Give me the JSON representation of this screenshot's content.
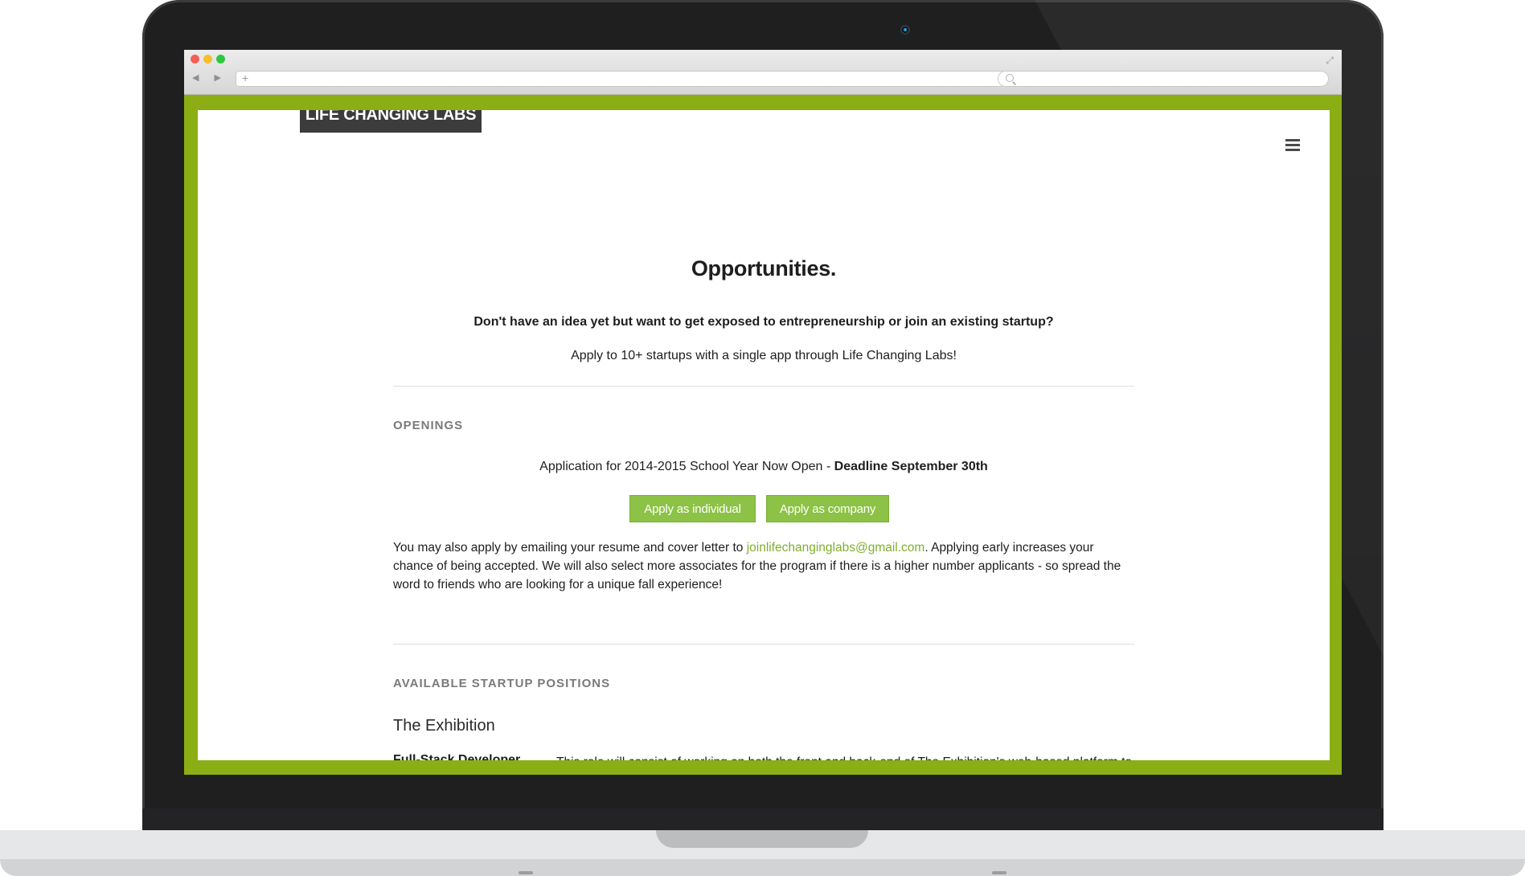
{
  "browser": {
    "nav_arrows": "◀ ▶",
    "new_tab": "+",
    "expand": "⤢"
  },
  "site": {
    "logo": "LIFE CHANGING LABS",
    "menu_icon": "hamburger-icon"
  },
  "hero": {
    "title": "Opportunities.",
    "question": "Don't have an idea yet but want to get exposed to entrepreneurship or join an existing startup?",
    "subtitle": "Apply to 10+ startups with a single app through Life Changing Labs!"
  },
  "openings": {
    "label": "OPENINGS",
    "application_text": "Application for 2014-2015 School Year Now Open - ",
    "deadline": "Deadline September 30th",
    "apply_individual": "Apply as individual",
    "apply_company": "Apply as company",
    "para_before": "You may also apply by emailing your resume and cover letter to ",
    "email": "joinlifechanginglabs@gmail.com",
    "para_after": ". Applying early increases your chance of being accepted. We will also select more associates for the program if there is a higher number applicants - so spread the word to friends who are looking for a unique fall experience!"
  },
  "positions": {
    "label": "AVAILABLE STARTUP POSITIONS",
    "company": "The Exhibition",
    "role": "Full-Stack Developer",
    "description": "This role will consist of working on both the front and back-end of The Exhibition's web-based platform to make it smooth, efficient, and bug-free as possible. Some of the tasks of the job are to implement mobile-friendly responsive web-based pages with pixel-perfect design, create, design and implement new"
  },
  "colors": {
    "accent_green": "#8aae14",
    "button_green": "#8cc245",
    "link_green": "#7fae2d",
    "logo_bg": "#3c3c3c"
  }
}
